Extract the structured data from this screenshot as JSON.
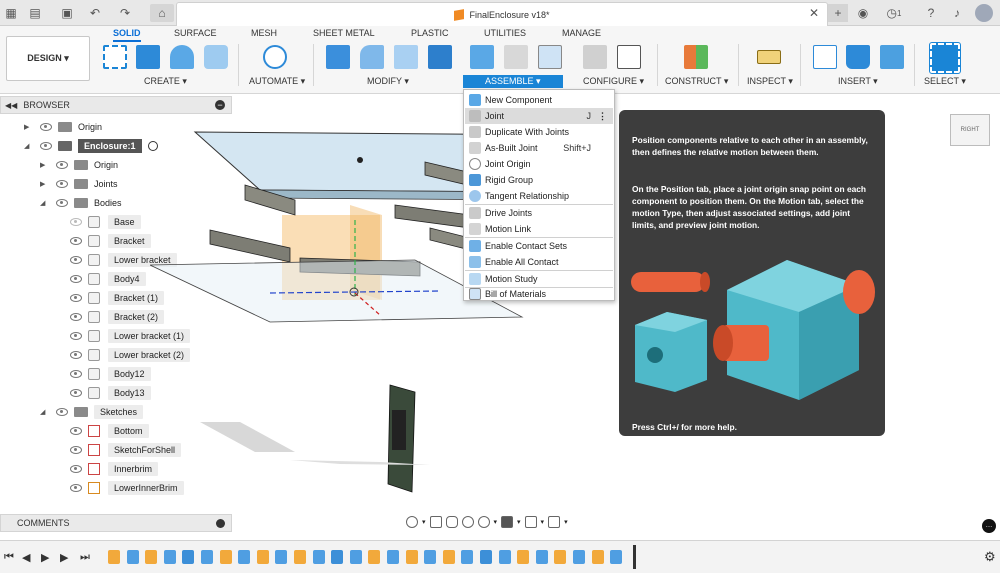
{
  "titlebar": {
    "document_title": "FinalEnclosure v18*",
    "notification_count": "1",
    "icons": [
      "grid-icon",
      "file-icon",
      "save-icon",
      "undo-icon",
      "redo-icon",
      "home-icon",
      "close-icon",
      "new-tab-icon",
      "extensions-icon",
      "clock-icon",
      "help-icon",
      "bell-icon",
      "user-avatar"
    ]
  },
  "toolbar": {
    "workspace_button": "DESIGN ▾",
    "tabs": [
      "SOLID",
      "SURFACE",
      "MESH",
      "SHEET METAL",
      "PLASTIC",
      "UTILITIES",
      "MANAGE"
    ],
    "active_tab": "SOLID",
    "groups": {
      "create": "CREATE ▾",
      "automate": "AUTOMATE ▾",
      "modify": "MODIFY ▾",
      "assemble": "ASSEMBLE ▾",
      "configure": "CONFIGURE ▾",
      "construct": "CONSTRUCT ▾",
      "inspect": "INSPECT ▾",
      "insert": "INSERT ▾",
      "select": "SELECT ▾"
    }
  },
  "browser": {
    "title": "BROWSER",
    "items": [
      {
        "label": "Origin"
      },
      {
        "label": "Enclosure:1"
      },
      {
        "label": "Origin"
      },
      {
        "label": "Joints"
      },
      {
        "label": "Bodies"
      },
      {
        "label": "Base"
      },
      {
        "label": "Bracket"
      },
      {
        "label": "Lower bracket"
      },
      {
        "label": "Body4"
      },
      {
        "label": "Bracket (1)"
      },
      {
        "label": "Bracket (2)"
      },
      {
        "label": "Lower bracket (1)"
      },
      {
        "label": "Lower bracket (2)"
      },
      {
        "label": "Body12"
      },
      {
        "label": "Body13"
      },
      {
        "label": "Sketches"
      },
      {
        "label": "Bottom"
      },
      {
        "label": "SketchForShell"
      },
      {
        "label": "Innerbrim"
      },
      {
        "label": "LowerInnerBrim"
      }
    ]
  },
  "comments": {
    "title": "COMMENTS"
  },
  "assemble_menu": {
    "items": [
      {
        "label": "New Component",
        "shortcut": ""
      },
      {
        "label": "Joint",
        "shortcut": "J"
      },
      {
        "label": "Duplicate With Joints",
        "shortcut": ""
      },
      {
        "label": "As-Built Joint",
        "shortcut": "Shift+J"
      },
      {
        "label": "Joint Origin",
        "shortcut": ""
      },
      {
        "label": "Rigid Group",
        "shortcut": ""
      },
      {
        "label": "Tangent Relationship",
        "shortcut": ""
      },
      {
        "label": "Drive Joints",
        "shortcut": ""
      },
      {
        "label": "Motion Link",
        "shortcut": ""
      },
      {
        "label": "Enable Contact Sets",
        "shortcut": ""
      },
      {
        "label": "Enable All Contact",
        "shortcut": ""
      },
      {
        "label": "Motion Study",
        "shortcut": ""
      },
      {
        "label": "Bill of Materials",
        "shortcut": ""
      }
    ],
    "more_icon": "⋮"
  },
  "help": {
    "paragraph1": "Position components relative to each other in an assembly, then defines the relative motion between them.",
    "paragraph2": "On the Position tab, place a joint origin snap point on each component to position them. On the Motion tab, select the motion Type, then adjust associated settings, add joint limits, and preview joint motion.",
    "footer": "Press Ctrl+/ for more help."
  },
  "viewcube": {
    "face": "RIGHT"
  },
  "colors": {
    "accent": "#1a85d6",
    "help_bg": "#3d3d3d",
    "help_blue": "#4fb9c9",
    "help_orange": "#e8613c"
  }
}
